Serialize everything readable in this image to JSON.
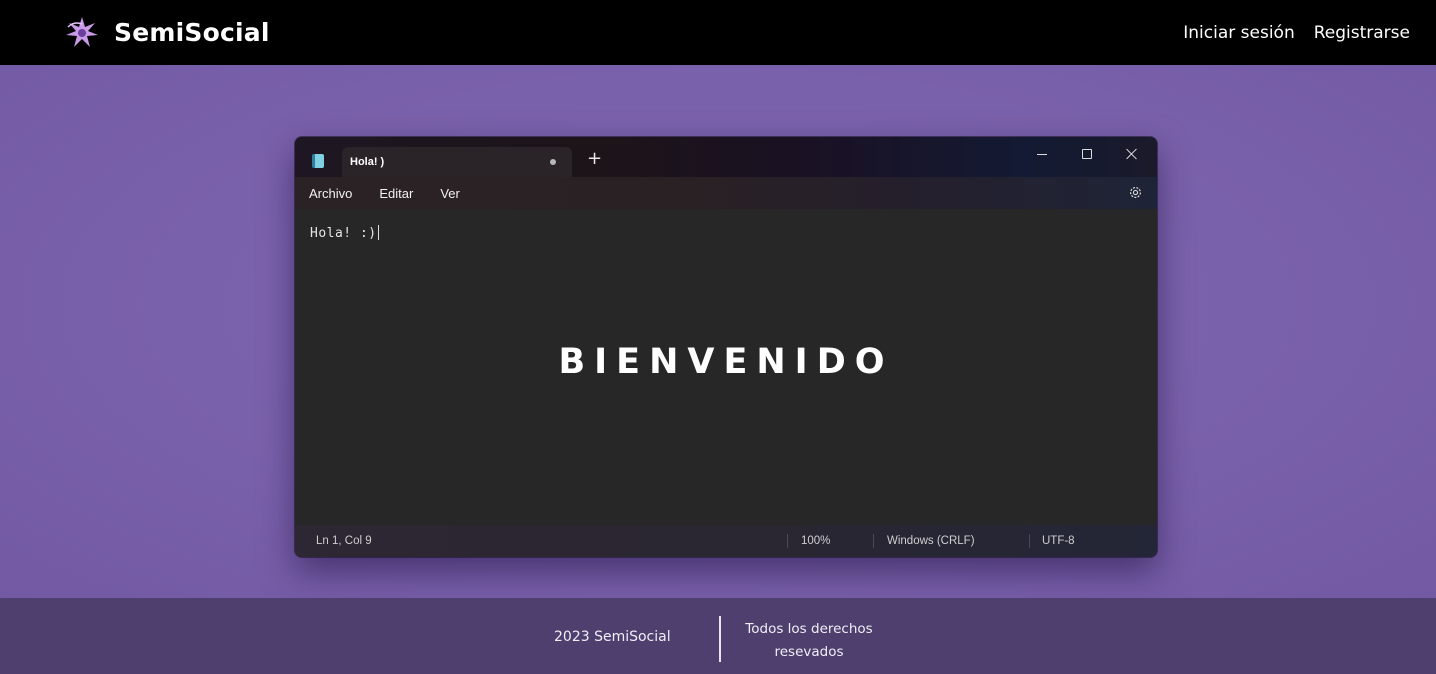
{
  "brand": {
    "name": "SemiSocial",
    "logo_icon": "semisocial-logo-icon"
  },
  "nav": {
    "login": "Iniciar sesión",
    "register": "Registrarse"
  },
  "notepad": {
    "tab_title": "Hola! )",
    "add_tab": "+",
    "menu": {
      "file": "Archivo",
      "edit": "Editar",
      "view": "Ver"
    },
    "content": "Hola! :)",
    "welcome": "BIENVENIDO",
    "status": {
      "position": "Ln 1, Col 9",
      "zoom": "100%",
      "line_ending": "Windows (CRLF)",
      "encoding": "UTF-8"
    }
  },
  "footer": {
    "copyright": "2023 SemiSocial",
    "rights_line1": "Todos los derechos",
    "rights_line2": "resevados"
  },
  "colors": {
    "page_bg": "#7b63ad",
    "topbar_bg": "#000000",
    "footer_bg": "#4f3f6e",
    "window_bg": "#272727"
  }
}
